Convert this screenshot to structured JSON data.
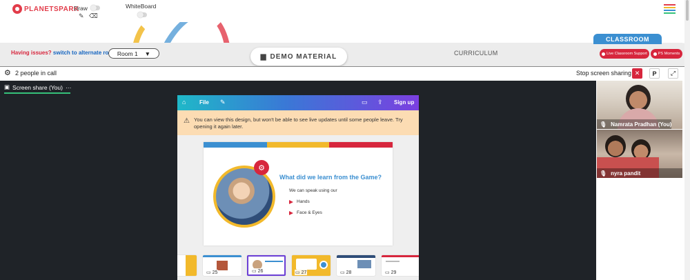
{
  "brand": {
    "name": "PLANETSPARK"
  },
  "toolbar": {
    "draw_label": "Draw",
    "whiteboard_label": "WhiteBoard",
    "pencil_icon": "pencil-icon",
    "eraser_icon": "eraser-icon"
  },
  "menu_colors": [
    "#e23c4a",
    "#f2b92b",
    "#3b8fd1",
    "#35c27a"
  ],
  "banner": {
    "issues_text": "Having issues?",
    "switch_link": "switch to alternate room",
    "room_value": "Room 1",
    "demo_material": "DEMO MATERIAL",
    "curriculum": "CURRICULUM",
    "classroom": "CLASSROOM",
    "live_support": "Live Classroom Support",
    "ps_moments": "PS Moments"
  },
  "call": {
    "people_count": "2 people in call",
    "stop_sharing": "Stop screen sharing",
    "stop_btn": "✕",
    "p_btn": "P",
    "expand_icon": "expand-icon"
  },
  "share": {
    "tab_label": "Screen share (You)",
    "more": "···"
  },
  "canva": {
    "file": "File",
    "signup": "Sign up",
    "notice": "You can view this design, but won't be able to see live updates until some people leave. Try opening it again later.",
    "slide_title": "What did we learn from the Game?",
    "slide_sub": "We can speak using our",
    "bullets": [
      "Hands",
      "Face & Eyes"
    ],
    "thumbs": [
      "25",
      "26",
      "27",
      "28",
      "29"
    ],
    "selected_thumb": "26"
  },
  "participants": [
    {
      "name": "Namrata Pradhan (You)"
    },
    {
      "name": "nyra pandit"
    }
  ],
  "colors": {
    "accent_red": "#d7263d",
    "accent_blue": "#3b8fd1",
    "accent_yellow": "#f2b92b",
    "stage_bg": "#1f2328"
  }
}
